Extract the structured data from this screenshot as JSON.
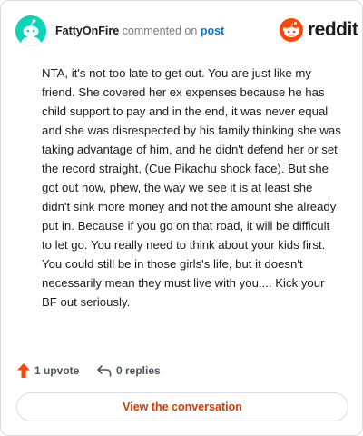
{
  "header": {
    "username": "FattyOnFire",
    "verb": "commented on",
    "post_link": "post",
    "brand_name": "reddit"
  },
  "comment": {
    "text": "NTA, it's not too late to get out. You are just like my friend. She covered her ex expenses because he has child support to pay and in the end, it was never equal and she was disrespected by his family thinking she was taking advantage of him, and he didn't defend her or set the record straight, (Cue Pikachu shock face). But she got out now, phew, the way we see it is at least she didn't sink more money and not the amount she already put in. Because if you go on that road, it will be difficult to let go. You really need to think about your kids first. You could still be in those girls's life, but it doesn't necessarily mean they must live with you.... Kick your BF out seriously."
  },
  "actions": {
    "upvotes": "1 upvote",
    "replies": "0 replies"
  },
  "view_button": "View the conversation",
  "colors": {
    "brand_orange": "#ff4500",
    "avatar_teal": "#0dd3bb",
    "link_blue": "#0079d3",
    "button_text": "#d93a00"
  },
  "icons": {
    "avatar": "snoo-avatar-icon",
    "brand": "reddit-logo-icon",
    "upvote": "upvote-arrow-icon",
    "reply": "reply-arrow-icon"
  }
}
